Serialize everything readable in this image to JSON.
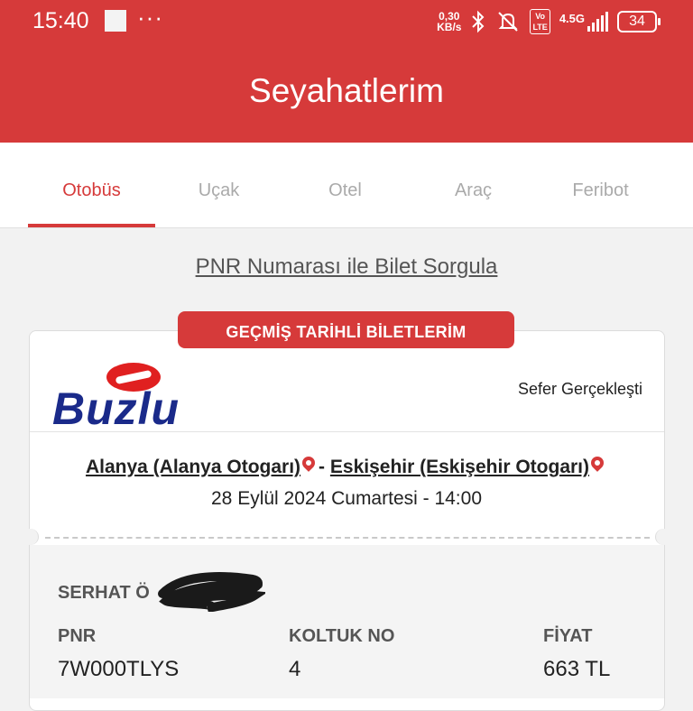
{
  "status_bar": {
    "time": "15:40",
    "more": "···",
    "network_speed_top": "0,30",
    "network_speed_bottom": "KB/s",
    "volte_top": "Vo",
    "volte_bottom": "LTE",
    "network_type": "4.5G",
    "battery": "34"
  },
  "header": {
    "title": "Seyahatlerim"
  },
  "tabs": [
    {
      "label": "Otobüs",
      "active": true
    },
    {
      "label": "Uçak",
      "active": false
    },
    {
      "label": "Otel",
      "active": false
    },
    {
      "label": "Araç",
      "active": false
    },
    {
      "label": "Feribot",
      "active": false
    }
  ],
  "pnr_link": "PNR Numarası ile Bilet Sorgula",
  "section_badge": "GEÇMİŞ TARİHLİ BİLETLERİM",
  "ticket": {
    "company": "Buzlu",
    "status": "Sefer Gerçekleşti",
    "origin": "Alanya (Alanya Otogarı)",
    "separator": "-",
    "destination": "Eskişehir (Eskişehir Otogarı)",
    "datetime": "28 Eylül 2024 Cumartesi - 14:00",
    "passenger": "SERHAT Ö",
    "pnr_label": "PNR",
    "pnr_value": "7W000TLYS",
    "seat_label": "KOLTUK NO",
    "seat_value": "4",
    "price_label": "FİYAT",
    "price_value": "663 TL"
  },
  "colors": {
    "primary": "#d63a3a",
    "logo_blue": "#1a2a8a"
  }
}
